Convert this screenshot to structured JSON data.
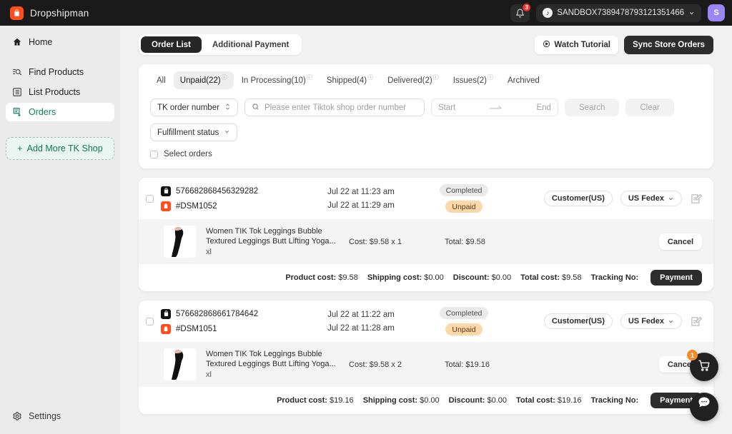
{
  "topbar": {
    "brand": "Dropshipman",
    "notifications_count": "3",
    "shop_name": "SANDBOX7389478793121351466",
    "avatar_initial": "S"
  },
  "sidebar": {
    "items": [
      {
        "label": "Home",
        "icon": "home-icon",
        "active": false
      },
      {
        "label": "Find Products",
        "icon": "find-products-icon",
        "active": false
      },
      {
        "label": "List Products",
        "icon": "list-products-icon",
        "active": false
      },
      {
        "label": "Orders",
        "icon": "orders-icon",
        "active": true
      }
    ],
    "add_shop_label": "Add More TK Shop",
    "settings_label": "Settings"
  },
  "header": {
    "tabs": [
      {
        "label": "Order List",
        "active": true
      },
      {
        "label": "Additional Payment",
        "active": false
      }
    ],
    "watch_tutorial": "Watch Tutorial",
    "sync_store_orders": "Sync Store Orders"
  },
  "filters": {
    "status_tabs": [
      {
        "label": "All",
        "active": false,
        "help": false
      },
      {
        "label": "Unpaid(22)",
        "active": true,
        "help": true
      },
      {
        "label": "In Processing(10)",
        "active": false,
        "help": true
      },
      {
        "label": "Shipped(4)",
        "active": false,
        "help": true
      },
      {
        "label": "Delivered(2)",
        "active": false,
        "help": true
      },
      {
        "label": "Issues(2)",
        "active": false,
        "help": true
      },
      {
        "label": "Archived",
        "active": false,
        "help": false
      }
    ],
    "order_number_select": "TK order number",
    "search_placeholder": "Please enter Tiktok shop order number",
    "search_value": "",
    "date_start_placeholder": "Start",
    "date_end_placeholder": "End",
    "search_button": "Search",
    "clear_button": "Clear",
    "fulfillment_status": "Fulfillment status",
    "select_orders": "Select orders"
  },
  "orders": [
    {
      "tk_order_number": "576682868456329282",
      "dsm_order_number": "#DSM1052",
      "created_time": "Jul 22 at 11:23 am",
      "paid_time": "Jul 22 at 11:29 am",
      "status_badge": "Completed",
      "payment_badge": "Unpaid",
      "customer": "Customer(US)",
      "shipping_method": "US Fedex",
      "product": {
        "title": "Women TIK Tok Leggings Bubble Textured Leggings Butt Lifting Yoga...",
        "variant": "xl",
        "cost": "Cost: $9.58 x 1",
        "total": "Total: $9.58"
      },
      "cancel_label": "Cancel",
      "summary": {
        "product_cost_label": "Product cost:",
        "product_cost": "$9.58",
        "shipping_cost_label": "Shipping cost:",
        "shipping_cost": "$0.00",
        "discount_label": "Discount:",
        "discount": "$0.00",
        "total_cost_label": "Total cost:",
        "total_cost": "$9.58",
        "tracking_label": "Tracking No:",
        "tracking_no": "",
        "payment_label": "Payment"
      }
    },
    {
      "tk_order_number": "576682868661784642",
      "dsm_order_number": "#DSM1051",
      "created_time": "Jul 22 at 11:22 am",
      "paid_time": "Jul 22 at 11:28 am",
      "status_badge": "Completed",
      "payment_badge": "Unpaid",
      "customer": "Customer(US)",
      "shipping_method": "US Fedex",
      "product": {
        "title": "Women TIK Tok Leggings Bubble Textured Leggings Butt Lifting Yoga...",
        "variant": "xl",
        "cost": "Cost: $9.58 x 2",
        "total": "Total: $19.16"
      },
      "cancel_label": "Cancel",
      "summary": {
        "product_cost_label": "Product cost:",
        "product_cost": "$19.16",
        "shipping_cost_label": "Shipping cost:",
        "shipping_cost": "$0.00",
        "discount_label": "Discount:",
        "discount": "$0.00",
        "total_cost_label": "Total cost:",
        "total_cost": "$19.16",
        "tracking_label": "Tracking No:",
        "tracking_no": "",
        "payment_label": "Payment"
      }
    }
  ],
  "floating": {
    "cart_badge": "1"
  },
  "colors": {
    "brand_orange": "#ff4d1c",
    "accent_green": "#108060",
    "dark": "#262626",
    "unpaid_badge": "#fbd7aa",
    "avatar": "#9a86f5"
  }
}
